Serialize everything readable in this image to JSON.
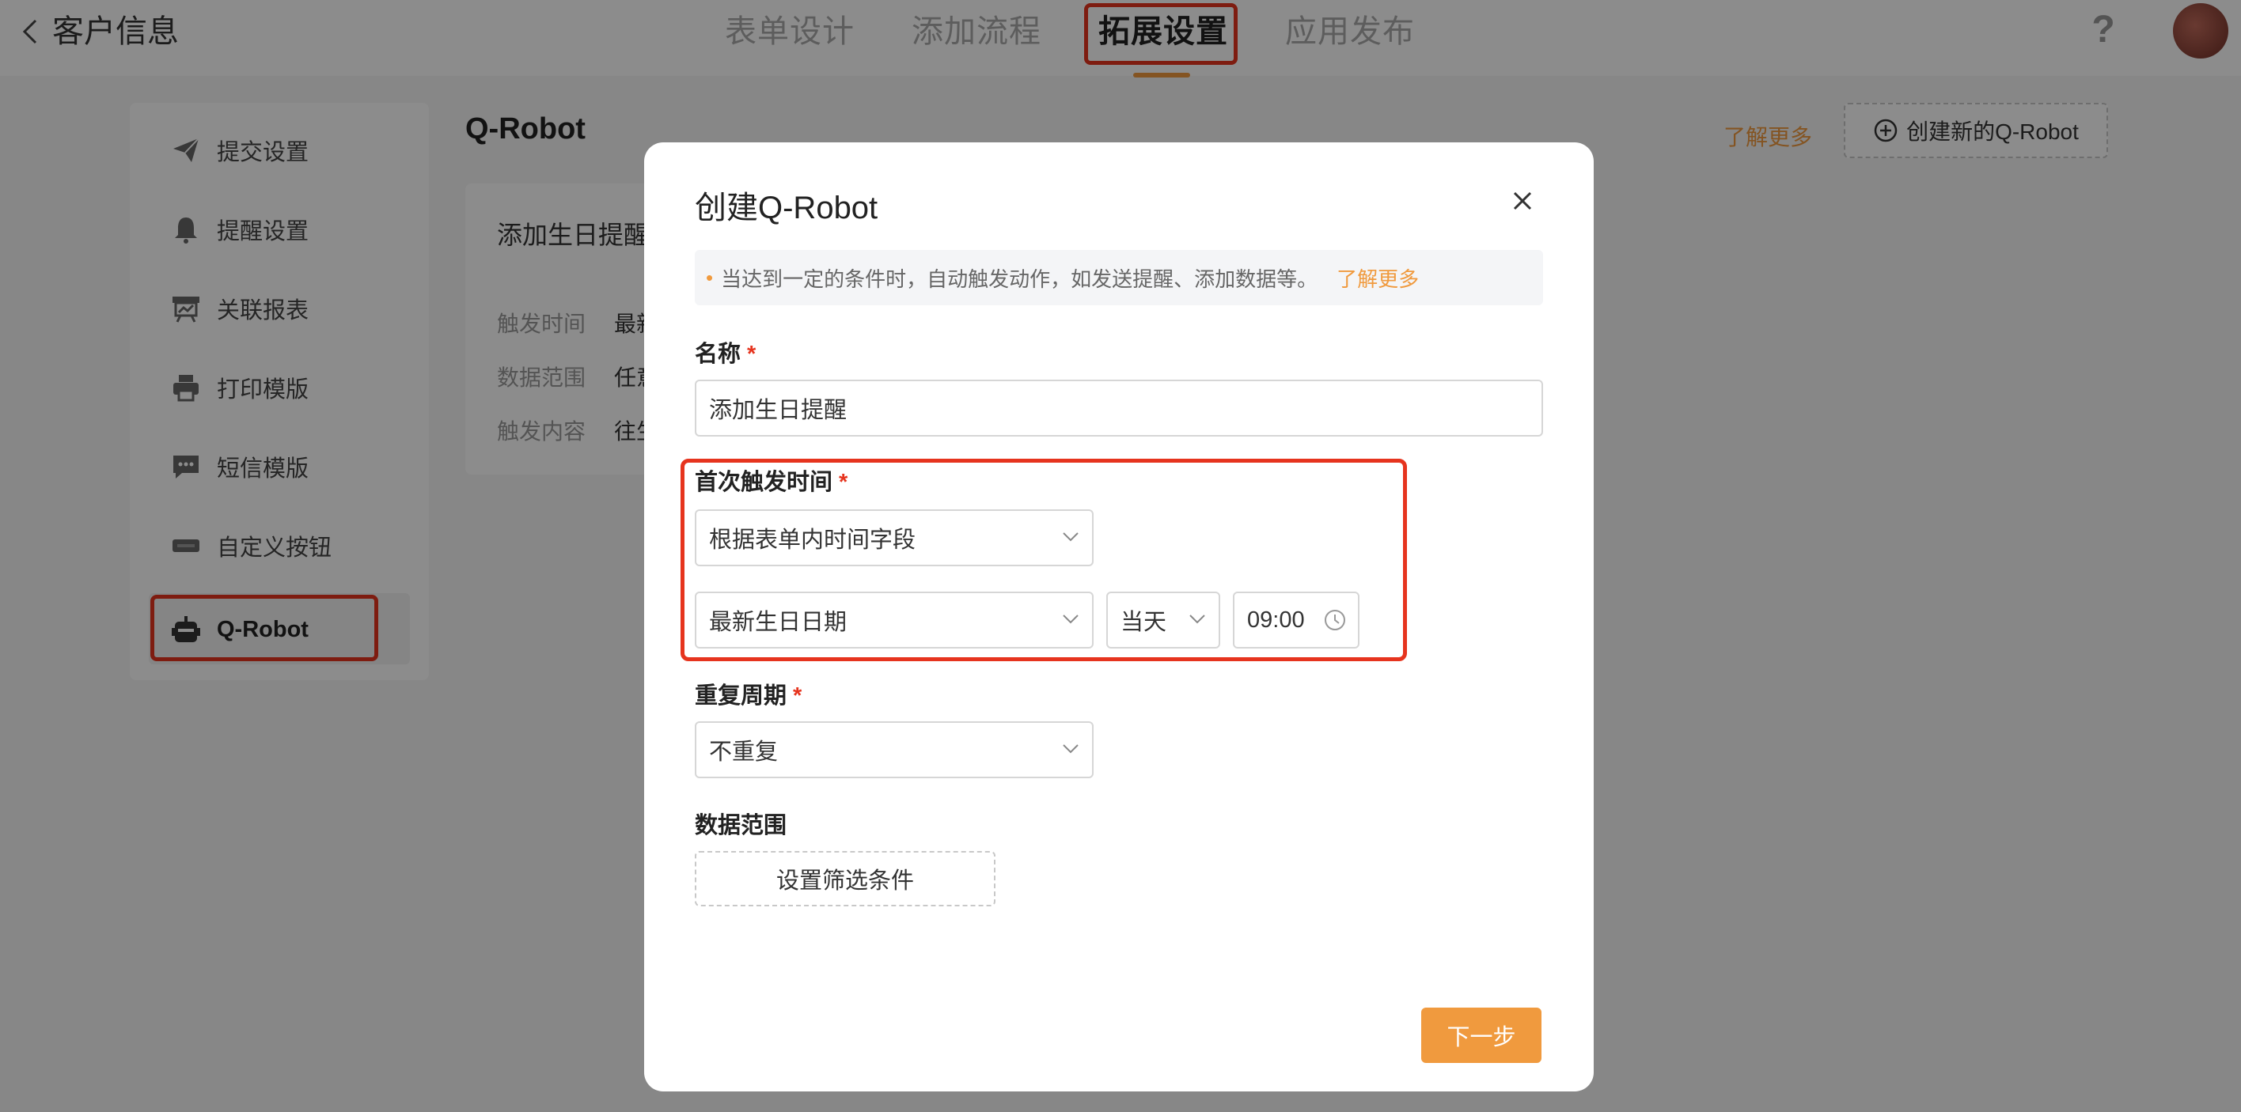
{
  "header": {
    "title": "客户信息",
    "tabs": [
      {
        "label": "表单设计"
      },
      {
        "label": "添加流程"
      },
      {
        "label": "拓展设置"
      },
      {
        "label": "应用发布"
      }
    ],
    "help_label": "?"
  },
  "sidebar": {
    "items": [
      {
        "label": "提交设置",
        "icon": "send-icon"
      },
      {
        "label": "提醒设置",
        "icon": "bell-icon"
      },
      {
        "label": "关联报表",
        "icon": "board-icon"
      },
      {
        "label": "打印模版",
        "icon": "printer-icon"
      },
      {
        "label": "短信模版",
        "icon": "message-icon"
      },
      {
        "label": "自定义按钮",
        "icon": "button-icon"
      },
      {
        "label": "Q-Robot",
        "icon": "robot-icon"
      }
    ]
  },
  "main": {
    "title": "Q-Robot",
    "learn_more": "了解更多",
    "create_button": "创建新的Q-Robot",
    "card": {
      "title": "添加生日提醒",
      "rows": [
        {
          "key": "触发时间",
          "value": "最新"
        },
        {
          "key": "数据范围",
          "value": "任意"
        },
        {
          "key": "触发内容",
          "value": "往生"
        }
      ]
    }
  },
  "modal": {
    "title": "创建Q-Robot",
    "notice": "当达到一定的条件时，自动触发动作，如发送提醒、添加数据等。",
    "notice_link": "了解更多",
    "name_label": "名称",
    "name_value": "添加生日提醒",
    "first_trigger_label": "首次触发时间",
    "trigger_mode": "根据表单内时间字段",
    "trigger_field": "最新生日日期",
    "trigger_day": "当天",
    "trigger_time": "09:00",
    "repeat_label": "重复周期",
    "repeat_value": "不重复",
    "scope_label": "数据范围",
    "filter_button": "设置筛选条件",
    "next_button": "下一步",
    "required_mark": "*"
  },
  "colors": {
    "accent": "#f09a3e",
    "highlight": "#e6341e"
  }
}
